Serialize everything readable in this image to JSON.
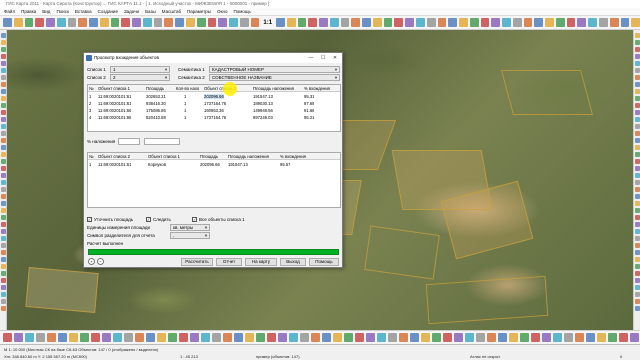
{
  "window": {
    "title": "ГИС Карта 2011 - Карта Сирота (Конструктор) ... ГИС КАРТА 11.1 - [ 1. Исходный участок - МИЖЗЕМЛЯ 1 - 0000001 - пример ]"
  },
  "menu": [
    "Файл",
    "Правка",
    "Вид",
    "Поиск",
    "Вставка",
    "Создание",
    "Задачи",
    "Базы",
    "Масштаб",
    "Параметры",
    "Окно",
    "Помощь"
  ],
  "toolbar": {
    "scale_label": "1:1"
  },
  "dialog": {
    "title": "Просмотр вхождения объектов",
    "controls": {
      "minimize": "—",
      "maximize": "☐",
      "close": "✕"
    },
    "list1_label": "Список 1",
    "list1_value": "1",
    "list2_label": "Список 2",
    "list2_value": "2",
    "sem1_label": "Семантика 1",
    "sem1_value": "КАДАСТРОВЫЙ НОМЕР",
    "sem2_label": "Семантика 2",
    "sem2_value": "СОБСТВЕННОЕ НАЗВАНИЕ",
    "table1": {
      "headers": [
        "№",
        "Объект списка 1",
        "Площадь",
        "Кол-во нахо",
        "Объект списка 2",
        "Площадь наложения",
        "% вхождения"
      ],
      "rows": [
        [
          "1",
          "11:69:0020101:61",
          "202653.21",
          "1",
          "202096.66",
          "191547.13",
          "95.31"
        ],
        [
          "2",
          "11:69:0020101:61",
          "938416.30",
          "1",
          "1737164.76",
          "189030.13",
          "97.69"
        ],
        [
          "3",
          "11:69:0020101:66",
          "175086.86",
          "1",
          "160953.36",
          "149948.56",
          "91.66"
        ],
        [
          "4",
          "11:69:0020101:68",
          "820410.88",
          "1",
          "1737164.76",
          "897249.03",
          "95.21"
        ]
      ]
    },
    "overlay_label": "% наложения",
    "table2": {
      "headers": [
        "№",
        "Объект списка 2",
        "Объект списка 1",
        "Площадь",
        "Площадь наложения",
        "% вхождения"
      ],
      "rows": [
        [
          "1",
          "11:69:0020101:61",
          "Корнуков",
          "202096.66",
          "191547.13",
          "95.57"
        ]
      ]
    },
    "options": {
      "calc_area": "Уточнить площадь",
      "follow": "Следить",
      "all_objects": "Все объекты списка 1",
      "units_label": "Единицы измерения площади",
      "units_value": "кв. метры",
      "separator_label": "Символ разделителя для отчета",
      "separator_value": ",",
      "status": "Расчет выполнен"
    },
    "buttons": {
      "calculate": "Рассчитать",
      "report": "Отчет",
      "on_map": "На карту",
      "exit": "Выход",
      "help": "Помощь"
    },
    "progress": 1.0
  },
  "statusbar": {
    "line1": "М 1: 10 000 (Местная СК на базе СК-63 Объектов: 147 / 0 (отображено / выделено)",
    "coords": "Xm: 348 840.60 m   Y: 2 155 557.20 m   (МСК00)",
    "scale": "1 : 45 213",
    "doc": "пример   (объектов: 147)",
    "atlas": "Атлас не открыт",
    "extra": "0"
  },
  "colors": {
    "accent": "#3b6fb6",
    "progress": "#06b025",
    "selection": "#cfe3f7",
    "cursor_highlight": "#fff000"
  }
}
